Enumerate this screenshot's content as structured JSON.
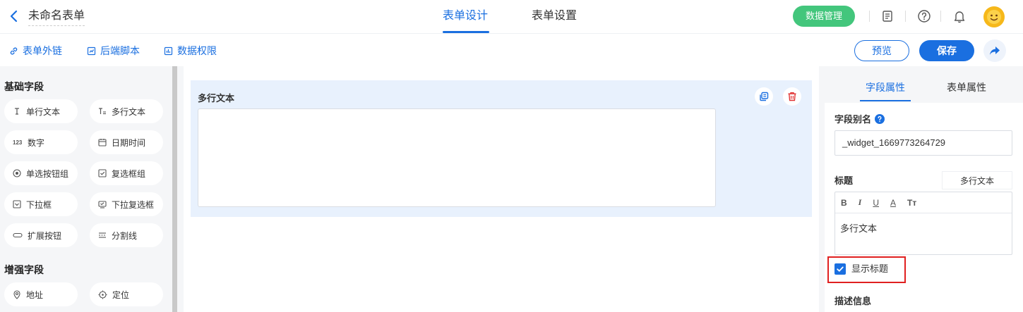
{
  "header": {
    "form_title": "未命名表单",
    "tabs": [
      {
        "label": "表单设计",
        "active": true
      },
      {
        "label": "表单设置",
        "active": false
      }
    ],
    "data_manage_label": "数据管理",
    "accent_color": "#1a6fe0",
    "data_button_color": "#43c67c"
  },
  "toolbar": {
    "links": [
      {
        "label": "表单外链",
        "icon": "link-icon"
      },
      {
        "label": "后端脚本",
        "icon": "script-icon"
      },
      {
        "label": "数据权限",
        "icon": "chart-icon"
      }
    ],
    "preview_label": "预览",
    "save_label": "保存"
  },
  "left_panel": {
    "basic_title": "基础字段",
    "basic_fields": [
      {
        "label": "单行文本",
        "icon": "text-cursor-icon"
      },
      {
        "label": "多行文本",
        "icon": "multiline-text-icon"
      },
      {
        "label": "数字",
        "icon": "number-icon"
      },
      {
        "label": "日期时间",
        "icon": "calendar-icon"
      },
      {
        "label": "单选按钮组",
        "icon": "radio-icon"
      },
      {
        "label": "复选框组",
        "icon": "checkbox-icon"
      },
      {
        "label": "下拉框",
        "icon": "dropdown-icon"
      },
      {
        "label": "下拉复选框",
        "icon": "dropdown-checkbox-icon"
      },
      {
        "label": "扩展按钮",
        "icon": "button-icon"
      },
      {
        "label": "分割线",
        "icon": "divider-icon"
      }
    ],
    "advanced_title": "增强字段",
    "advanced_fields": [
      {
        "label": "地址",
        "icon": "map-pin-icon"
      },
      {
        "label": "定位",
        "icon": "crosshair-icon"
      }
    ]
  },
  "canvas": {
    "field_label": "多行文本"
  },
  "right_panel": {
    "tabs": [
      {
        "label": "字段属性",
        "active": true
      },
      {
        "label": "表单属性",
        "active": false
      }
    ],
    "alias_label": "字段别名",
    "alias_value": "_widget_1669773264729",
    "title_label": "标题",
    "title_tag": "多行文本",
    "editor_buttons": [
      "B",
      "I",
      "U",
      "A",
      "Tт"
    ],
    "editor_content": "多行文本",
    "show_title_label": "显示标题",
    "show_title_checked": true,
    "description_label": "描述信息"
  }
}
